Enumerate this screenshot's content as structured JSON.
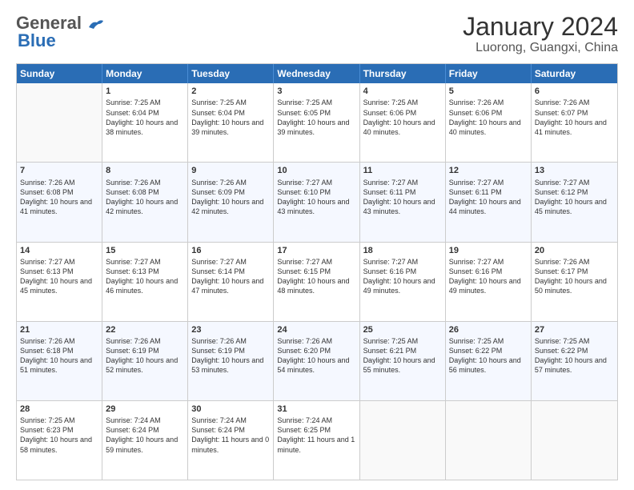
{
  "logo": {
    "general": "General",
    "blue": "Blue"
  },
  "title": "January 2024",
  "subtitle": "Luorong, Guangxi, China",
  "days": [
    "Sunday",
    "Monday",
    "Tuesday",
    "Wednesday",
    "Thursday",
    "Friday",
    "Saturday"
  ],
  "weeks": [
    [
      {
        "num": "",
        "sunrise": "",
        "sunset": "",
        "daylight": ""
      },
      {
        "num": "1",
        "sunrise": "Sunrise: 7:25 AM",
        "sunset": "Sunset: 6:04 PM",
        "daylight": "Daylight: 10 hours and 38 minutes."
      },
      {
        "num": "2",
        "sunrise": "Sunrise: 7:25 AM",
        "sunset": "Sunset: 6:04 PM",
        "daylight": "Daylight: 10 hours and 39 minutes."
      },
      {
        "num": "3",
        "sunrise": "Sunrise: 7:25 AM",
        "sunset": "Sunset: 6:05 PM",
        "daylight": "Daylight: 10 hours and 39 minutes."
      },
      {
        "num": "4",
        "sunrise": "Sunrise: 7:25 AM",
        "sunset": "Sunset: 6:06 PM",
        "daylight": "Daylight: 10 hours and 40 minutes."
      },
      {
        "num": "5",
        "sunrise": "Sunrise: 7:26 AM",
        "sunset": "Sunset: 6:06 PM",
        "daylight": "Daylight: 10 hours and 40 minutes."
      },
      {
        "num": "6",
        "sunrise": "Sunrise: 7:26 AM",
        "sunset": "Sunset: 6:07 PM",
        "daylight": "Daylight: 10 hours and 41 minutes."
      }
    ],
    [
      {
        "num": "7",
        "sunrise": "Sunrise: 7:26 AM",
        "sunset": "Sunset: 6:08 PM",
        "daylight": "Daylight: 10 hours and 41 minutes."
      },
      {
        "num": "8",
        "sunrise": "Sunrise: 7:26 AM",
        "sunset": "Sunset: 6:08 PM",
        "daylight": "Daylight: 10 hours and 42 minutes."
      },
      {
        "num": "9",
        "sunrise": "Sunrise: 7:26 AM",
        "sunset": "Sunset: 6:09 PM",
        "daylight": "Daylight: 10 hours and 42 minutes."
      },
      {
        "num": "10",
        "sunrise": "Sunrise: 7:27 AM",
        "sunset": "Sunset: 6:10 PM",
        "daylight": "Daylight: 10 hours and 43 minutes."
      },
      {
        "num": "11",
        "sunrise": "Sunrise: 7:27 AM",
        "sunset": "Sunset: 6:11 PM",
        "daylight": "Daylight: 10 hours and 43 minutes."
      },
      {
        "num": "12",
        "sunrise": "Sunrise: 7:27 AM",
        "sunset": "Sunset: 6:11 PM",
        "daylight": "Daylight: 10 hours and 44 minutes."
      },
      {
        "num": "13",
        "sunrise": "Sunrise: 7:27 AM",
        "sunset": "Sunset: 6:12 PM",
        "daylight": "Daylight: 10 hours and 45 minutes."
      }
    ],
    [
      {
        "num": "14",
        "sunrise": "Sunrise: 7:27 AM",
        "sunset": "Sunset: 6:13 PM",
        "daylight": "Daylight: 10 hours and 45 minutes."
      },
      {
        "num": "15",
        "sunrise": "Sunrise: 7:27 AM",
        "sunset": "Sunset: 6:13 PM",
        "daylight": "Daylight: 10 hours and 46 minutes."
      },
      {
        "num": "16",
        "sunrise": "Sunrise: 7:27 AM",
        "sunset": "Sunset: 6:14 PM",
        "daylight": "Daylight: 10 hours and 47 minutes."
      },
      {
        "num": "17",
        "sunrise": "Sunrise: 7:27 AM",
        "sunset": "Sunset: 6:15 PM",
        "daylight": "Daylight: 10 hours and 48 minutes."
      },
      {
        "num": "18",
        "sunrise": "Sunrise: 7:27 AM",
        "sunset": "Sunset: 6:16 PM",
        "daylight": "Daylight: 10 hours and 49 minutes."
      },
      {
        "num": "19",
        "sunrise": "Sunrise: 7:27 AM",
        "sunset": "Sunset: 6:16 PM",
        "daylight": "Daylight: 10 hours and 49 minutes."
      },
      {
        "num": "20",
        "sunrise": "Sunrise: 7:26 AM",
        "sunset": "Sunset: 6:17 PM",
        "daylight": "Daylight: 10 hours and 50 minutes."
      }
    ],
    [
      {
        "num": "21",
        "sunrise": "Sunrise: 7:26 AM",
        "sunset": "Sunset: 6:18 PM",
        "daylight": "Daylight: 10 hours and 51 minutes."
      },
      {
        "num": "22",
        "sunrise": "Sunrise: 7:26 AM",
        "sunset": "Sunset: 6:19 PM",
        "daylight": "Daylight: 10 hours and 52 minutes."
      },
      {
        "num": "23",
        "sunrise": "Sunrise: 7:26 AM",
        "sunset": "Sunset: 6:19 PM",
        "daylight": "Daylight: 10 hours and 53 minutes."
      },
      {
        "num": "24",
        "sunrise": "Sunrise: 7:26 AM",
        "sunset": "Sunset: 6:20 PM",
        "daylight": "Daylight: 10 hours and 54 minutes."
      },
      {
        "num": "25",
        "sunrise": "Sunrise: 7:25 AM",
        "sunset": "Sunset: 6:21 PM",
        "daylight": "Daylight: 10 hours and 55 minutes."
      },
      {
        "num": "26",
        "sunrise": "Sunrise: 7:25 AM",
        "sunset": "Sunset: 6:22 PM",
        "daylight": "Daylight: 10 hours and 56 minutes."
      },
      {
        "num": "27",
        "sunrise": "Sunrise: 7:25 AM",
        "sunset": "Sunset: 6:22 PM",
        "daylight": "Daylight: 10 hours and 57 minutes."
      }
    ],
    [
      {
        "num": "28",
        "sunrise": "Sunrise: 7:25 AM",
        "sunset": "Sunset: 6:23 PM",
        "daylight": "Daylight: 10 hours and 58 minutes."
      },
      {
        "num": "29",
        "sunrise": "Sunrise: 7:24 AM",
        "sunset": "Sunset: 6:24 PM",
        "daylight": "Daylight: 10 hours and 59 minutes."
      },
      {
        "num": "30",
        "sunrise": "Sunrise: 7:24 AM",
        "sunset": "Sunset: 6:24 PM",
        "daylight": "Daylight: 11 hours and 0 minutes."
      },
      {
        "num": "31",
        "sunrise": "Sunrise: 7:24 AM",
        "sunset": "Sunset: 6:25 PM",
        "daylight": "Daylight: 11 hours and 1 minute."
      },
      {
        "num": "",
        "sunrise": "",
        "sunset": "",
        "daylight": ""
      },
      {
        "num": "",
        "sunrise": "",
        "sunset": "",
        "daylight": ""
      },
      {
        "num": "",
        "sunrise": "",
        "sunset": "",
        "daylight": ""
      }
    ]
  ]
}
